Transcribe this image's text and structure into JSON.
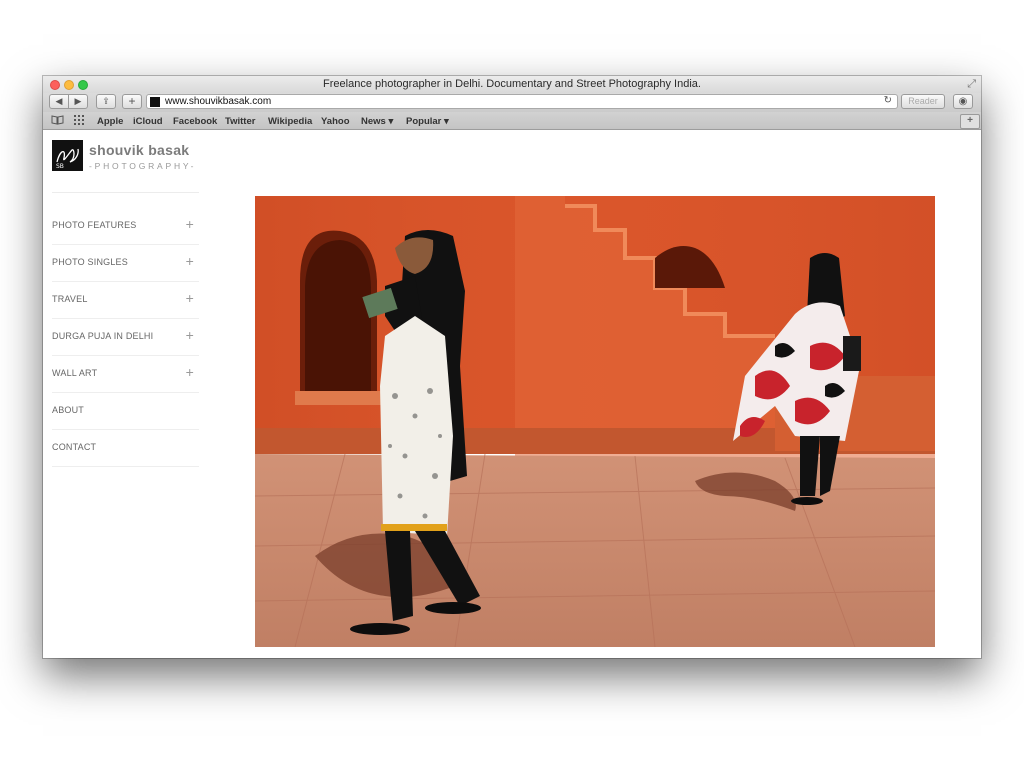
{
  "window": {
    "title": "Freelance photographer in Delhi. Documentary and Street Photography India."
  },
  "toolbar": {
    "back_label": "◀",
    "forward_label": "▶",
    "share_label": "⇪",
    "add_label": "+",
    "url": "www.shouvikbasak.com",
    "reload_label": "↻",
    "reader_label": "Reader",
    "download_label": "◉"
  },
  "bookmarks": {
    "reading_list_icon": "book-icon",
    "top_sites_icon": "grid-icon",
    "items": [
      {
        "label": "Apple"
      },
      {
        "label": "iCloud"
      },
      {
        "label": "Facebook"
      },
      {
        "label": "Twitter"
      },
      {
        "label": "Wikipedia"
      },
      {
        "label": "Yahoo"
      },
      {
        "label": "News ▾"
      },
      {
        "label": "Popular ▾"
      }
    ],
    "new_tab_label": "+"
  },
  "site": {
    "logo_mark_text": "SB",
    "name": "shouvik basak",
    "tagline": "-PHOTOGRAPHY-"
  },
  "nav": {
    "items": [
      {
        "label": "PHOTO FEATURES",
        "expand": "+"
      },
      {
        "label": "PHOTO SINGLES",
        "expand": "+"
      },
      {
        "label": "TRAVEL",
        "expand": "+"
      },
      {
        "label": "DURGA PUJA IN DELHI",
        "expand": "+"
      },
      {
        "label": "WALL ART",
        "expand": "+"
      },
      {
        "label": "ABOUT",
        "expand": ""
      },
      {
        "label": "CONTACT",
        "expand": ""
      }
    ]
  },
  "colors": {
    "wall": "#d9532a",
    "floor": "#c9876c",
    "text_nav": "#666666"
  }
}
